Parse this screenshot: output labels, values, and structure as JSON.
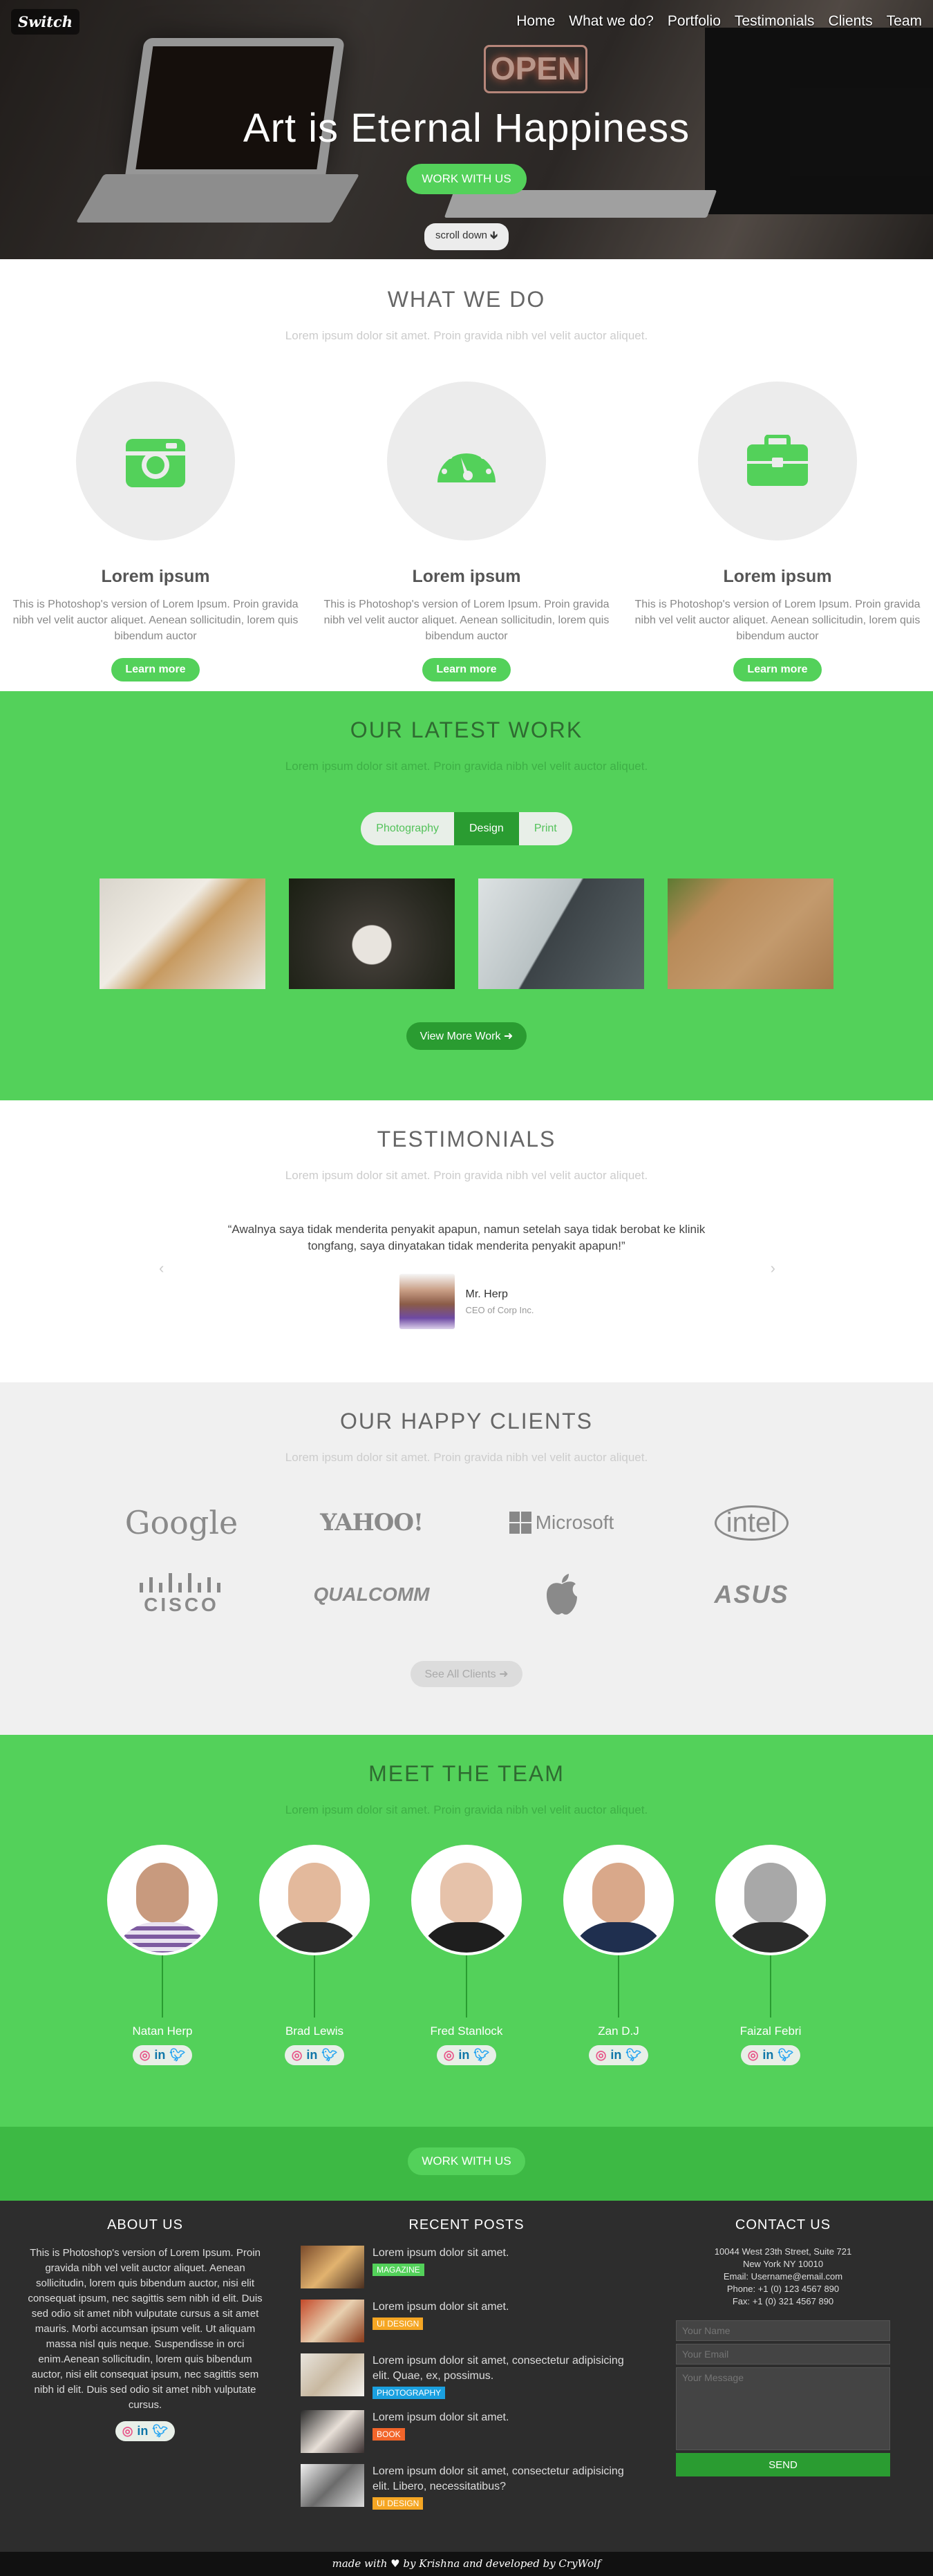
{
  "brand": "Switch",
  "nav": [
    "Home",
    "What we do?",
    "Portfolio",
    "Testimonials",
    "Clients",
    "Team"
  ],
  "hero": {
    "sign": "OPEN",
    "title": "Art is Eternal Happiness",
    "cta": "WORK WITH US",
    "scroll": "scroll down"
  },
  "what_we_do": {
    "title": "WHAT WE DO",
    "subtitle": "Lorem ipsum dolor sit amet. Proin gravida nibh vel velit auctor aliquet.",
    "features": [
      {
        "icon": "camera-icon",
        "title": "Lorem ipsum",
        "text": "This is Photoshop's version of Lorem Ipsum. Proin gravida nibh vel velit auctor aliquet. Aenean sollicitudin, lorem quis bibendum auctor",
        "button": "Learn more"
      },
      {
        "icon": "speedometer-icon",
        "title": "Lorem ipsum",
        "text": "This is Photoshop's version of Lorem Ipsum. Proin gravida nibh vel velit auctor aliquet. Aenean sollicitudin, lorem quis bibendum auctor",
        "button": "Learn more"
      },
      {
        "icon": "briefcase-icon",
        "title": "Lorem ipsum",
        "text": "This is Photoshop's version of Lorem Ipsum. Proin gravida nibh vel velit auctor aliquet. Aenean sollicitudin, lorem quis bibendum auctor",
        "button": "Learn more"
      }
    ]
  },
  "latest_work": {
    "title": "OUR LATEST WORK",
    "subtitle": "Lorem ipsum dolor sit amet. Proin gravida nibh vel velit auctor aliquet.",
    "filters": [
      "Photography",
      "Design",
      "Print"
    ],
    "active_filter": "Design",
    "button": "View More Work"
  },
  "testimonials": {
    "title": "TESTIMONIALS",
    "subtitle": "Lorem ipsum dolor sit amet. Proin gravida nibh vel velit auctor aliquet.",
    "quote": "“Awalnya saya tidak menderita penyakit apapun, namun setelah saya tidak berobat ke klinik tongfang, saya dinyatakan tidak menderita penyakit apapun!”",
    "author_name": "Mr. Herp",
    "author_role": "CEO of Corp Inc.",
    "prev": "‹",
    "next": "›"
  },
  "clients": {
    "title": "OUR HAPPY CLIENTS",
    "subtitle": "Lorem ipsum dolor sit amet. Proin gravida nibh vel velit auctor aliquet.",
    "logos": [
      "Google",
      "YAHOO!",
      "Microsoft",
      "intel",
      "CISCO",
      "QUALCOMM",
      "apple-icon",
      "ASUS"
    ],
    "button": "See All Clients"
  },
  "team": {
    "title": "MEET THE TEAM",
    "subtitle": "Lorem ipsum dolor sit amet. Proin gravida nibh vel velit auctor aliquet.",
    "members": [
      "Natan Herp",
      "Brad Lewis",
      "Fred Stanlock",
      "Zan D.J",
      "Faizal Febri"
    ],
    "cta": "WORK WITH US"
  },
  "footer": {
    "about_title": "ABOUT US",
    "about_text": "This is Photoshop's version of Lorem Ipsum. Proin gravida nibh vel velit auctor aliquet. Aenean sollicitudin, lorem quis bibendum auctor, nisi elit consequat ipsum, nec sagittis sem nibh id elit. Duis sed odio sit amet nibh vulputate cursus a sit amet mauris. Morbi accumsan ipsum velit. Ut aliquam massa nisl quis neque. Suspendisse in orci enim.Aenean sollicitudin, lorem quis bibendum auctor, nisi elit consequat ipsum, nec sagittis sem nibh id elit. Duis sed odio sit amet nibh vulputate cursus.",
    "posts_title": "RECENT POSTS",
    "posts": [
      {
        "text": "Lorem ipsum dolor sit amet.",
        "tag": "MAGAZINE",
        "tag_color": "#53d15a"
      },
      {
        "text": "Lorem ipsum dolor sit amet.",
        "tag": "UI DESIGN",
        "tag_color": "#f5a623"
      },
      {
        "text": "Lorem ipsum dolor sit amet, consectetur adipisicing elit. Quae, ex, possimus.",
        "tag": "PHOTOGRAPHY",
        "tag_color": "#1aa0e0"
      },
      {
        "text": "Lorem ipsum dolor sit amet.",
        "tag": "BOOK",
        "tag_color": "#f2652a"
      },
      {
        "text": "Lorem ipsum dolor sit amet, consectetur adipisicing elit. Libero, necessitatibus?",
        "tag": "UI DESIGN",
        "tag_color": "#f5a623"
      }
    ],
    "contact_title": "CONTACT US",
    "address": [
      "10044 West 23th Street, Suite 721",
      "New York NY 10010",
      "Email: Username@email.com",
      "Phone: +1 (0) 123 4567 890",
      "Fax: +1 (0) 321 4567 890"
    ],
    "name_placeholder": "Your Name",
    "email_placeholder": "Your Email",
    "message_placeholder": "Your Message",
    "send": "SEND",
    "credit": "made with ♥ by Krishna and developed by CryWolf"
  }
}
